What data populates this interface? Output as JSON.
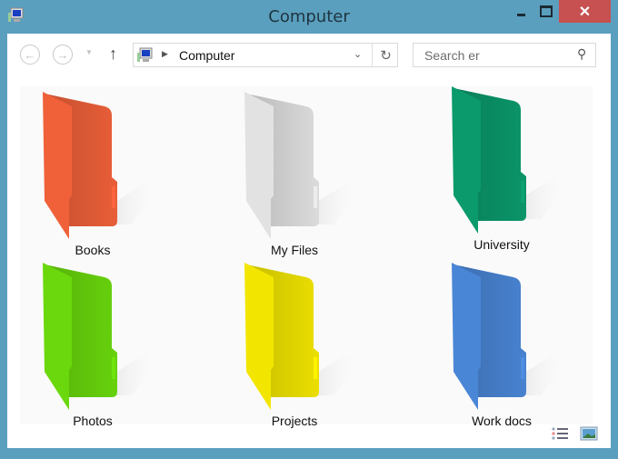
{
  "window": {
    "title": "Computer",
    "minimize": "minimize",
    "maximize": "maximize",
    "close": "✕"
  },
  "toolbar": {
    "back": "←",
    "forward": "→",
    "recent": "▼",
    "up": "↑"
  },
  "address": {
    "separator": "▶",
    "path": "Computer",
    "dropdown": "⌄",
    "refresh": "↻"
  },
  "search": {
    "placeholder": "Search er",
    "icon": "⚲"
  },
  "folders": [
    {
      "label": "Books",
      "color": "#f0613a"
    },
    {
      "label": "My Files",
      "color": "#e2e2e2"
    },
    {
      "label": "University",
      "color": "#0b9a6c"
    },
    {
      "label": "Photos",
      "color": "#6ad80c"
    },
    {
      "label": "Projects",
      "color": "#f2e600"
    },
    {
      "label": "Work docs",
      "color": "#4a86d6"
    }
  ],
  "colors": {
    "frame": "#5b9fbe",
    "close": "#c75050"
  }
}
